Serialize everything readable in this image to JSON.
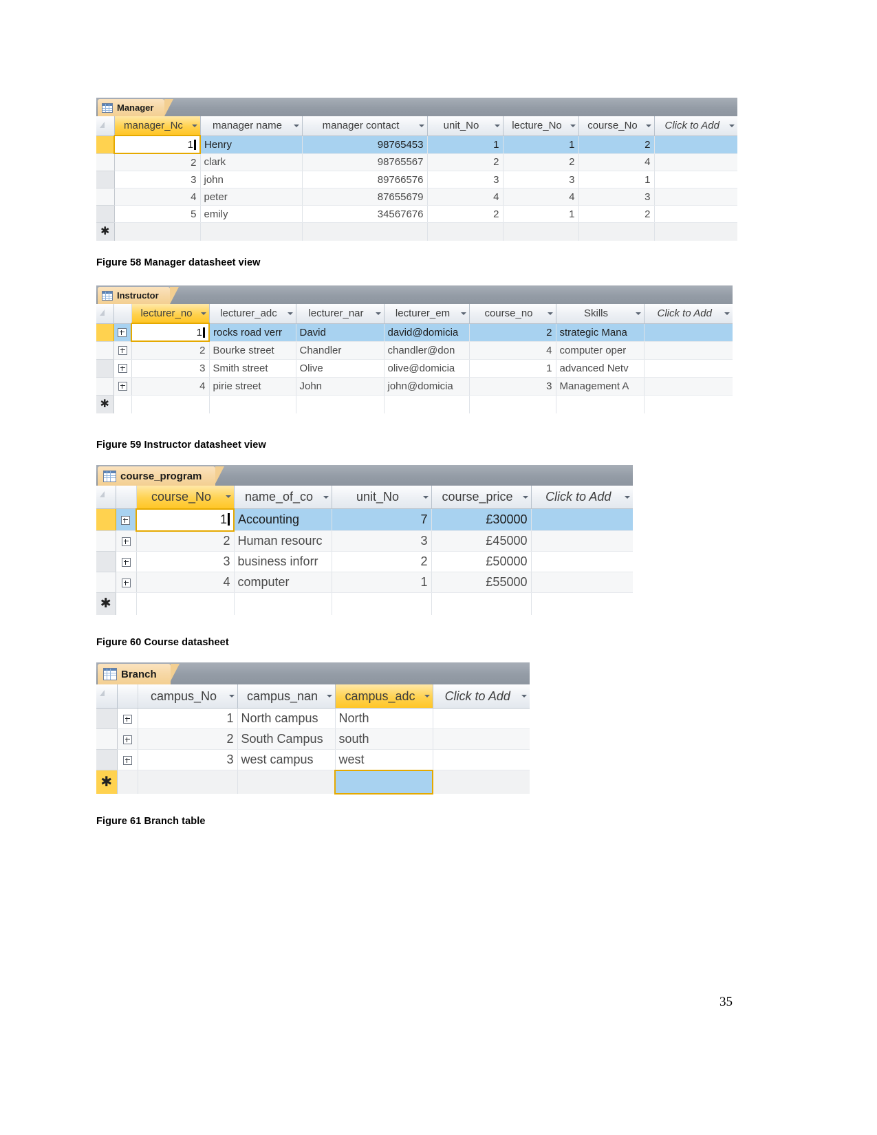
{
  "page": {
    "number": "35"
  },
  "figures": [
    {
      "caption": "Figure 58 Manager datasheet view",
      "table": {
        "tab_title": "Manager",
        "tab_icon": "table-icon",
        "add_column_label": "Click to Add",
        "columns": [
          {
            "label": "manager_Nc",
            "align": "left",
            "selected": true
          },
          {
            "label": "manager name",
            "align": "left",
            "selected": false
          },
          {
            "label": "manager contact",
            "align": "left",
            "selected": false
          },
          {
            "label": "unit_No",
            "align": "center",
            "selected": false
          },
          {
            "label": "lecture_No",
            "align": "center",
            "selected": false
          },
          {
            "label": "course_No",
            "align": "center",
            "selected": false
          }
        ],
        "rows": [
          {
            "selected": true,
            "cells": [
              "1",
              "Henry",
              "98765453",
              "1",
              "1",
              "2"
            ]
          },
          {
            "selected": false,
            "cells": [
              "2",
              "clark",
              "98765567",
              "2",
              "2",
              "4"
            ]
          },
          {
            "selected": false,
            "cells": [
              "3",
              "john",
              "89766576",
              "3",
              "3",
              "1"
            ]
          },
          {
            "selected": false,
            "cells": [
              "4",
              "peter",
              "87655679",
              "4",
              "4",
              "3"
            ]
          },
          {
            "selected": false,
            "cells": [
              "5",
              "emily",
              "34567676",
              "2",
              "1",
              "2"
            ]
          }
        ],
        "new_record_marker": "✱"
      }
    },
    {
      "caption": "Figure 59 Instructor datasheet view",
      "table": {
        "tab_title": "Instructor",
        "tab_icon": "table-icon",
        "add_column_label": "Click to Add",
        "columns": [
          {
            "label": "lecturer_no",
            "align": "center",
            "selected": true
          },
          {
            "label": "lecturer_adc",
            "align": "left",
            "selected": false
          },
          {
            "label": "lecturer_nar",
            "align": "left",
            "selected": false
          },
          {
            "label": "lecturer_em",
            "align": "left",
            "selected": false
          },
          {
            "label": "course_no",
            "align": "center",
            "selected": false
          },
          {
            "label": "Skills",
            "align": "center",
            "selected": false
          }
        ],
        "rows": [
          {
            "selected": true,
            "cells": [
              "1",
              "rocks road verr",
              "David",
              "david@domicia",
              "2",
              "strategic Mana"
            ]
          },
          {
            "selected": false,
            "cells": [
              "2",
              "Bourke street",
              "Chandler",
              "chandler@don",
              "4",
              "computer oper"
            ]
          },
          {
            "selected": false,
            "cells": [
              "3",
              "Smith street",
              "Olive",
              "olive@domicia",
              "1",
              "advanced Netv"
            ]
          },
          {
            "selected": false,
            "cells": [
              "4",
              "pirie street",
              "John",
              "john@domicia",
              "3",
              "Management A"
            ]
          }
        ],
        "new_record_marker": "✱"
      }
    },
    {
      "caption": "Figure 60 Course datasheet",
      "table": {
        "tab_title": "course_program",
        "tab_icon": "table-icon",
        "add_column_label": "Click to Add",
        "columns": [
          {
            "label": "course_No",
            "align": "center",
            "selected": true
          },
          {
            "label": "name_of_co",
            "align": "left",
            "selected": false
          },
          {
            "label": "unit_No",
            "align": "center",
            "selected": false
          },
          {
            "label": "course_price",
            "align": "left",
            "selected": false
          }
        ],
        "rows": [
          {
            "selected": true,
            "cells": [
              "1",
              "Accounting",
              "7",
              "£30000"
            ]
          },
          {
            "selected": false,
            "cells": [
              "2",
              "Human resourc",
              "3",
              "£45000"
            ]
          },
          {
            "selected": false,
            "cells": [
              "3",
              "business inforr",
              "2",
              "£50000"
            ]
          },
          {
            "selected": false,
            "cells": [
              "4",
              "computer",
              "1",
              "£55000"
            ]
          }
        ],
        "new_record_marker": "✱"
      }
    },
    {
      "caption": "Figure 61 Branch table",
      "table": {
        "tab_title": "Branch",
        "tab_icon": "table-icon",
        "add_column_label": "Click to Add",
        "columns": [
          {
            "label": "campus_No",
            "align": "center",
            "selected": false
          },
          {
            "label": "campus_nan",
            "align": "left",
            "selected": false
          },
          {
            "label": "campus_adc",
            "align": "left",
            "selected": true
          }
        ],
        "rows": [
          {
            "selected": false,
            "cells": [
              "1",
              "North campus",
              "North"
            ]
          },
          {
            "selected": false,
            "cells": [
              "2",
              "South Campus",
              "south"
            ]
          },
          {
            "selected": false,
            "cells": [
              "3",
              "west campus",
              "west"
            ]
          }
        ],
        "new_record_marker": "✱"
      }
    }
  ]
}
